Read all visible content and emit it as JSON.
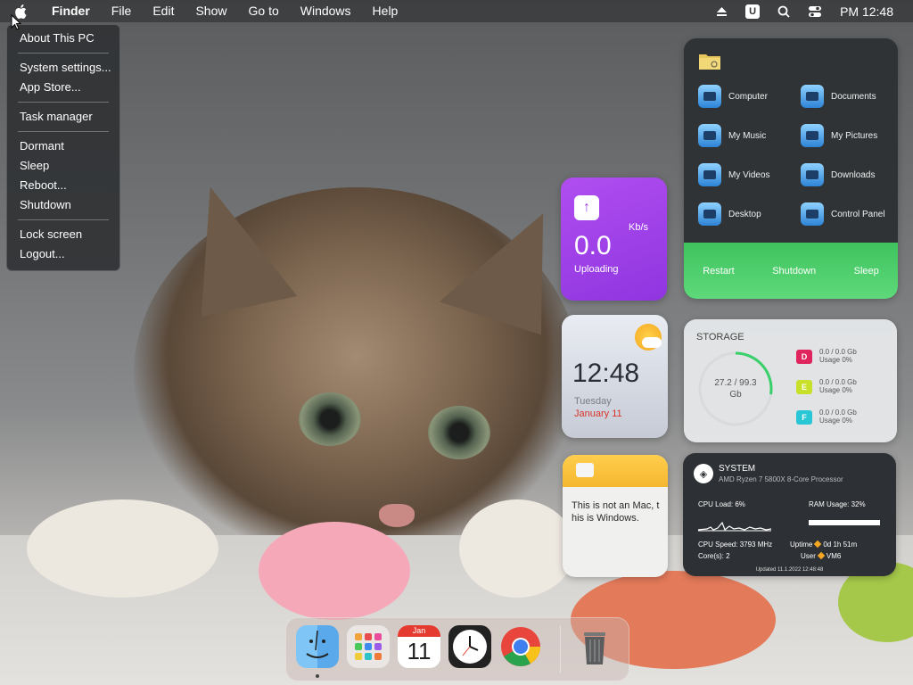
{
  "menubar": {
    "app_name": "Finder",
    "menus": [
      "File",
      "Edit",
      "Show",
      "Go to",
      "Windows",
      "Help"
    ],
    "clock": "PM 12:48",
    "status_icons": [
      "eject-icon",
      "u-icon",
      "search-icon",
      "control-center-icon"
    ],
    "u_label": "U"
  },
  "apple_menu": {
    "items": [
      "About This PC",
      "System settings...",
      "App Store...",
      "Task manager",
      "Dormant",
      "Sleep",
      "Reboot...",
      "Shutdown",
      "Lock screen",
      "Logout..."
    ]
  },
  "folders_widget": {
    "items": [
      "Computer",
      "Documents",
      "My Music",
      "My Pictures",
      "My Videos",
      "Downloads",
      "Desktop",
      "Control Panel"
    ],
    "actions": [
      "Restart",
      "Shutdown",
      "Sleep"
    ],
    "accent": "#4cc96a"
  },
  "upload_widget": {
    "unit": "Kb/s",
    "value": "0.0",
    "label": "Uploading",
    "accent": "#9a3fe6"
  },
  "clock_widget": {
    "time": "12:48",
    "weekday": "Tuesday",
    "date": "January 11"
  },
  "note_widget": {
    "text": "This is not an Mac, this is Windows."
  },
  "storage_widget": {
    "title": "STORAGE",
    "used": "27.2 / 99.3",
    "unit": "Gb",
    "used_fraction": 0.274,
    "drives": [
      {
        "letter": "D",
        "size": "0.0 / 0.0 Gb",
        "usage": "Usage 0%",
        "color": "#e0245e"
      },
      {
        "letter": "E",
        "size": "0.0 / 0.0 Gb",
        "usage": "Usage 0%",
        "color": "#c8e02a"
      },
      {
        "letter": "F",
        "size": "0.0 / 0.0 Gb",
        "usage": "Usage 0%",
        "color": "#29c7d6"
      }
    ]
  },
  "system_widget": {
    "title": "SYSTEM",
    "cpu_name": "AMD Ryzen 7 5800X 8-Core Processor",
    "cpu_load": "CPU Load: 6%",
    "ram_usage": "RAM Usage: 32%",
    "cpu_speed": "CPU Speed: 3793 MHz",
    "cores": "Core(s): 2",
    "uptime_label": "Uptime",
    "uptime_value": "0d 1h 51m",
    "user_label": "User",
    "user_value": "VM6",
    "updated": "Updated 11.1.2022 12:48:48"
  },
  "dock": {
    "apps": [
      "finder-icon",
      "launchpad-icon",
      "calendar-icon",
      "clock-icon",
      "chrome-icon"
    ],
    "calendar_month": "Jan",
    "calendar_day": "11",
    "trash": "trash-icon"
  }
}
